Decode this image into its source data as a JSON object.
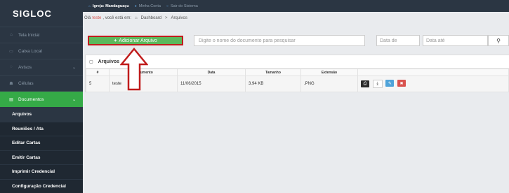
{
  "logo": "SIGLOC",
  "topbar": {
    "church": "Igreja: Mandaguaçu",
    "account": "Minha Conta",
    "logout": "Sair do Sistema"
  },
  "breadcrumb": {
    "prefix": "Olá",
    "user": "teste",
    "suffix": ", você está em:",
    "dashboard": "Dashboard",
    "sep": ">",
    "current": "Arquivos"
  },
  "sidebar": {
    "items": [
      {
        "label": "Tela Inicial",
        "icon": "home-icon"
      },
      {
        "label": "Caixa Local",
        "icon": "cash-icon"
      },
      {
        "label": "Avisos",
        "icon": "bell-icon"
      },
      {
        "label": "Células",
        "icon": "users-icon"
      },
      {
        "label": "Documentos",
        "icon": "file-icon"
      }
    ],
    "subitems": [
      "Arquivos",
      "Reuniões / Ata",
      "Editar Cartas",
      "Emitir Cartas",
      "Imprimir Credencial",
      "Configuração Credencial"
    ]
  },
  "toolbar": {
    "add_label": "Adicionar Arquivo",
    "search_placeholder": "Digite o nome do documento para pesquisar",
    "date_from": "Data de",
    "date_to": "Data até"
  },
  "panel": {
    "title": "Arquivos",
    "columns": [
      "#",
      "Documento",
      "Data",
      "Tamanho",
      "Extensão",
      ""
    ],
    "rows": [
      {
        "id": "5",
        "documento": "teste",
        "data": "11/06/2015",
        "tamanho": "3.94 KB",
        "extensao": ".PNG"
      }
    ]
  },
  "colors": {
    "sidebar": "#2b3643",
    "accent_green": "#5cb85c",
    "highlight_red": "#c01c1c"
  }
}
